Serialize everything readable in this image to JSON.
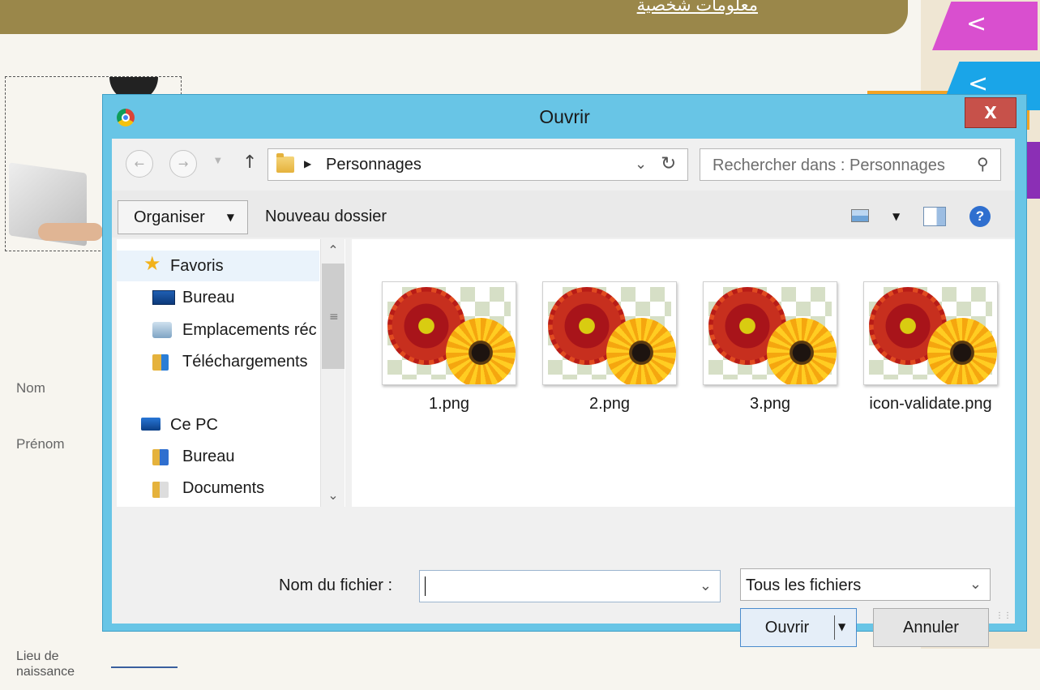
{
  "page": {
    "header_title": "معلومات شخصية",
    "form_labels": {
      "nom": "Nom",
      "prenom": "Prénom",
      "lieu_line1": "Lieu de",
      "lieu_line2": "naissance"
    },
    "ribbon_arrow": "<"
  },
  "dialog": {
    "title": "Ouvrir",
    "close_label": "X",
    "address": {
      "current_folder": "Personnages",
      "search_placeholder": "Rechercher dans : Personnages"
    },
    "toolbar": {
      "organiser_label": "Organiser",
      "new_folder_label": "Nouveau dossier",
      "help_label": "?"
    },
    "nav_pane": {
      "favorites_label": "Favoris",
      "favorites": [
        "Bureau",
        "Emplacements réc",
        "Téléchargements"
      ],
      "this_pc_label": "Ce PC",
      "pc_items": [
        "Bureau",
        "Documents"
      ]
    },
    "files": [
      {
        "name": "1.png"
      },
      {
        "name": "2.png"
      },
      {
        "name": "3.png"
      },
      {
        "name": "icon-validate.png"
      }
    ],
    "footer": {
      "filename_label": "Nom du fichier :",
      "filename_value": "",
      "filetype_value": "Tous les fichiers",
      "open_label": "Ouvrir",
      "cancel_label": "Annuler"
    }
  },
  "colors": {
    "dialog_frame": "#68c5e6",
    "close_button": "#c7514a",
    "header_band": "#9a874a",
    "ribbon_pink": "#d94fcf",
    "ribbon_blue": "#1aa5e8"
  },
  "icons": [
    "chrome-icon",
    "back-arrow-icon",
    "forward-arrow-icon",
    "up-arrow-icon",
    "folder-icon",
    "refresh-icon",
    "search-icon",
    "view-options-icon",
    "preview-pane-icon",
    "help-icon",
    "star-icon",
    "desktop-icon",
    "recent-places-icon",
    "downloads-folder-icon",
    "computer-icon",
    "documents-folder-icon"
  ]
}
